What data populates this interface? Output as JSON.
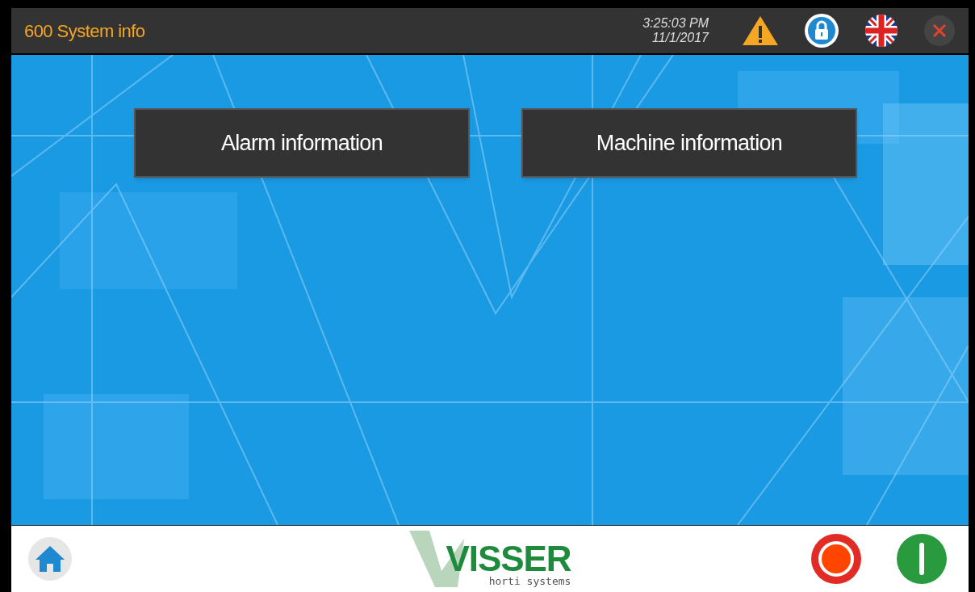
{
  "header": {
    "title": "600 System info",
    "time": "3:25:03 PM",
    "date": "11/1/2017"
  },
  "buttons": [
    {
      "label": "Alarm information"
    },
    {
      "label": "Machine information"
    }
  ],
  "footer": {
    "logo": {
      "name": "VISSER",
      "tagline": "horti systems"
    }
  }
}
